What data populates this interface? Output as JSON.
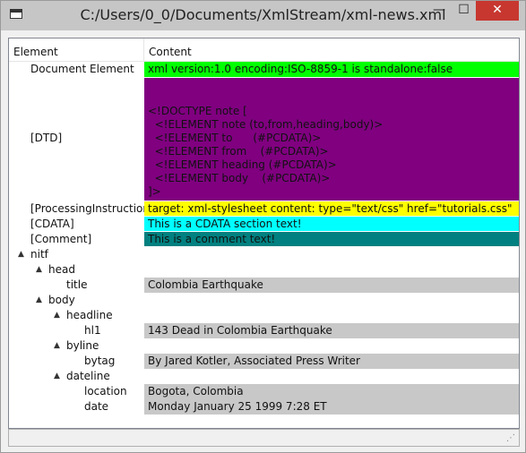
{
  "window": {
    "title": "C:/Users/0_0/Documents/XmlStream/xml-news.xml",
    "minimize_glyph": "—",
    "maximize_glyph": "☐",
    "close_glyph": "✕"
  },
  "columns": {
    "element": "Element",
    "content": "Content"
  },
  "rows": {
    "document": {
      "element": "Document Element",
      "content": "xml version:1.0    encoding:ISO-8859-1    is standalone:false"
    },
    "dtd": {
      "element": "[DTD]",
      "lines": [
        "<!DOCTYPE note [",
        "  <!ELEMENT note (to,from,heading,body)>",
        "  <!ELEMENT to      (#PCDATA)>",
        "  <!ELEMENT from    (#PCDATA)>",
        "  <!ELEMENT heading (#PCDATA)>",
        "  <!ELEMENT body    (#PCDATA)>",
        "]>"
      ]
    },
    "pi": {
      "element": "[ProcessingInstruction]",
      "content": "target: xml-stylesheet    content: type=\"text/css\" href=\"tutorials.css\""
    },
    "cdata": {
      "element": "[CDATA]",
      "content": " This is a CDATA section text!"
    },
    "comment": {
      "element": "[Comment]",
      "content": " This is a comment text!"
    },
    "nitf": {
      "element": "nitf"
    },
    "head": {
      "element": "head"
    },
    "title": {
      "element": "title",
      "content": "Colombia Earthquake"
    },
    "body": {
      "element": "body"
    },
    "headline": {
      "element": "headline"
    },
    "hl1": {
      "element": "hl1",
      "content": "143 Dead in Colombia Earthquake"
    },
    "byline": {
      "element": "byline"
    },
    "bytag": {
      "element": "bytag",
      "content": "By Jared Kotler, Associated Press Writer"
    },
    "dateline": {
      "element": "dateline"
    },
    "location": {
      "element": "location",
      "content": "Bogota, Colombia"
    },
    "date": {
      "element": "date",
      "content": "Monday January 25 1999 7:28 ET"
    }
  },
  "colors": {
    "document": "#00ff00",
    "dtd": "#800080",
    "pi": "#ffff00",
    "cdata": "#00ffff",
    "comment": "#008080",
    "text_node": "#c8c8c8",
    "close_button": "#c7372f"
  },
  "icons": {
    "expand_arrow": "▲",
    "window_icon": "window-icon"
  }
}
